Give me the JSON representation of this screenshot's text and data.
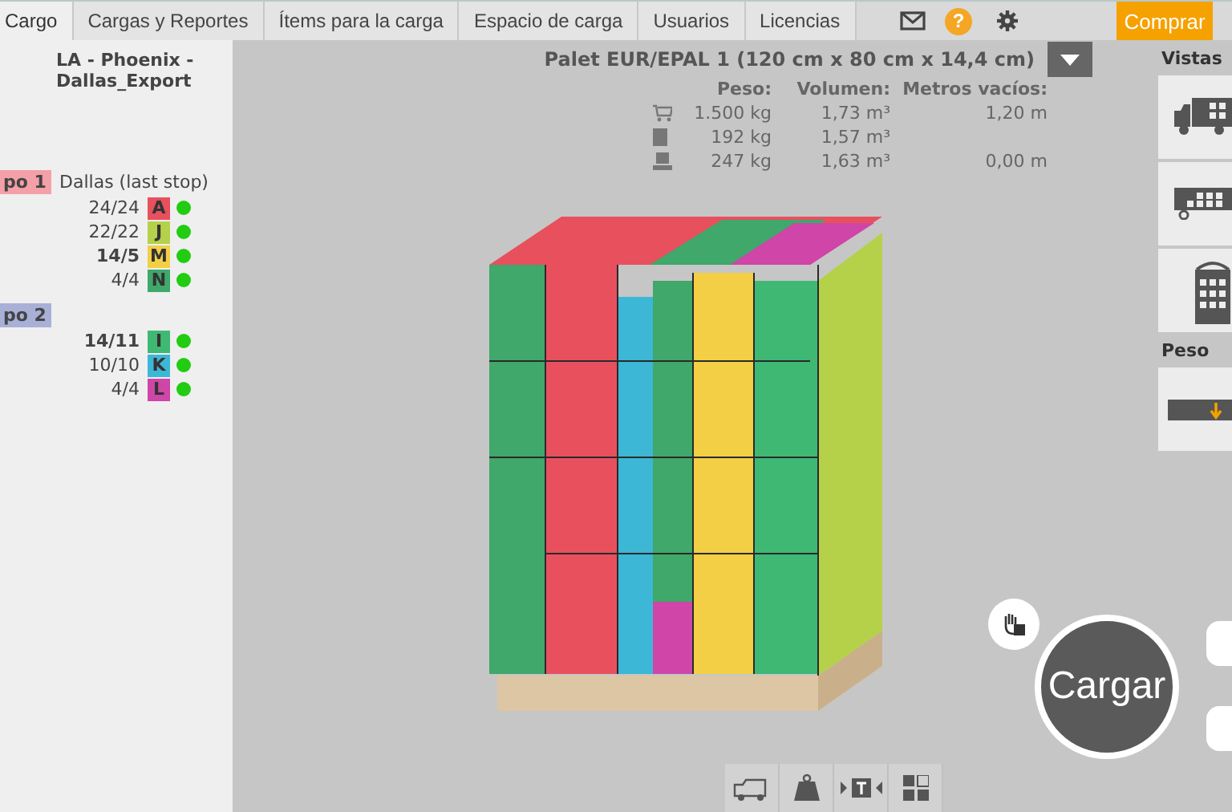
{
  "tabs": [
    {
      "label": "Cargo",
      "selected": true
    },
    {
      "label": "Cargas y Reportes",
      "selected": false
    },
    {
      "label": "Ítems para la carga",
      "selected": false
    },
    {
      "label": "Espacio de carga",
      "selected": false
    },
    {
      "label": "Usuarios",
      "selected": false
    },
    {
      "label": "Licencias",
      "selected": false
    }
  ],
  "help_label": "?",
  "buy_button": "Comprar",
  "load": {
    "title": "LA - Phoenix - Dallas_Export",
    "groups": [
      {
        "label": "po 1",
        "color": "#f4a0a8",
        "stop": "Dallas (last stop)",
        "items": [
          {
            "count": "24/24",
            "highlighted": false,
            "letter": "A",
            "color": "#e8505e"
          },
          {
            "count": "22/22",
            "highlighted": false,
            "letter": "J",
            "color": "#b5d14a"
          },
          {
            "count": "14/5",
            "highlighted": true,
            "letter": "M",
            "color": "#f2cf45"
          },
          {
            "count": "4/4",
            "highlighted": false,
            "letter": "N",
            "color": "#3fa86a"
          }
        ]
      },
      {
        "label": "po 2",
        "color": "#a9b0d8",
        "items": [
          {
            "count": "14/11",
            "highlighted": true,
            "letter": "I",
            "color": "#3fb874"
          },
          {
            "count": "10/10",
            "highlighted": false,
            "letter": "K",
            "color": "#3db7d6"
          },
          {
            "count": "4/4",
            "highlighted": false,
            "letter": "L",
            "color": "#cf45a8"
          }
        ]
      }
    ]
  },
  "space": {
    "title": "Palet EUR/EPAL 1 (120 cm x 80 cm x 14,4 cm)",
    "columns": [
      "Peso:",
      "Volumen:",
      "Metros vacíos:"
    ],
    "rows": [
      {
        "kind": "cart",
        "cells": [
          "1.500 kg",
          "1,73 m³",
          "1,20 m"
        ]
      },
      {
        "kind": "box",
        "cells": [
          "192 kg",
          "1,57 m³",
          ""
        ]
      },
      {
        "kind": "stack",
        "cells": [
          "247 kg",
          "1,63 m³",
          "0,00 m"
        ]
      }
    ]
  },
  "load_button": "Cargar",
  "views": {
    "title": "Vistas",
    "buttons": [
      {
        "kind": "side"
      },
      {
        "kind": "top"
      },
      {
        "kind": "back"
      }
    ]
  },
  "weight": {
    "title": "Peso"
  }
}
